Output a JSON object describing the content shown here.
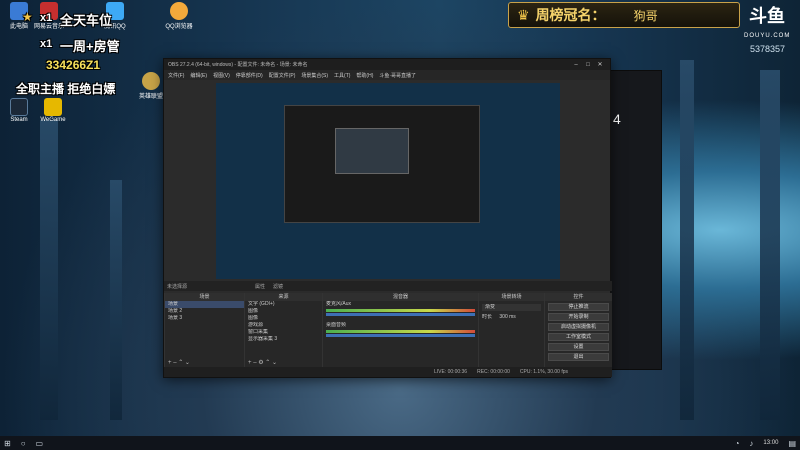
{
  "overlay": {
    "line1_count": "x1",
    "line1_text": "全天车位",
    "line2_count": "x1",
    "line2_text": "一周+房管",
    "qq": "334266Z1",
    "line3_text": "全职主播  拒绝白嫖"
  },
  "banner": {
    "title": "周榜冠名：",
    "name": "狗哥"
  },
  "douyu": {
    "logo": "斗鱼",
    "sub": "DOUYU.COM",
    "room_id": "5378357"
  },
  "desktop_icons": [
    {
      "label": "此电脑",
      "color": "#3a7bd5"
    },
    {
      "label": "网易云音乐",
      "color": "#c62f2f"
    },
    {
      "label": "腾讯QQ",
      "color": "#3da9f5"
    },
    {
      "label": "QQ浏览器",
      "color": "#f2a93b"
    },
    {
      "label": "Steam",
      "color": "#1b2838"
    },
    {
      "label": "WeGame",
      "color": "#e6b800"
    },
    {
      "label": "英雄联盟",
      "color": "#c8a448"
    }
  ],
  "obs": {
    "title": "OBS 27.2.4 (64-bit, windows) - 配置文件: 未命名 - 场景: 未命名",
    "menu": [
      "文件(F)",
      "编辑(E)",
      "视图(V)",
      "停靠部件(D)",
      "配置文件(P)",
      "场景集合(S)",
      "工具(T)",
      "帮助(H)",
      "斗鱼·哥哥直播了"
    ],
    "toolbar_label": "未选择源",
    "toolbar_props": "属性",
    "toolbar_filters": "滤镜",
    "scenes": {
      "title": "场景",
      "items": [
        "场景",
        "场景 2",
        "场景 3"
      ]
    },
    "sources": {
      "title": "来源",
      "items": [
        "文字 (GDI+)",
        "图像",
        "图像",
        "游戏源",
        "窗口采集",
        "显示器采集 3"
      ]
    },
    "mixer": {
      "title": "混音器",
      "tracks": [
        "麦克风/Aux",
        "桌面音频"
      ]
    },
    "transitions": {
      "title": "场景转场",
      "type": "渐变",
      "duration_label": "时长",
      "duration": "300 ms"
    },
    "controls": {
      "title": "控件",
      "buttons": [
        "停止推流",
        "开始录制",
        "启动虚拟摄像机",
        "工作室模式",
        "设置",
        "退出"
      ]
    },
    "status": {
      "live": "LIVE: 00:00:36",
      "rec": "REC: 00:00:00",
      "cpu": "CPU: 1.1%, 30.00 fps"
    }
  },
  "taskbar": {
    "time": "13:00"
  }
}
